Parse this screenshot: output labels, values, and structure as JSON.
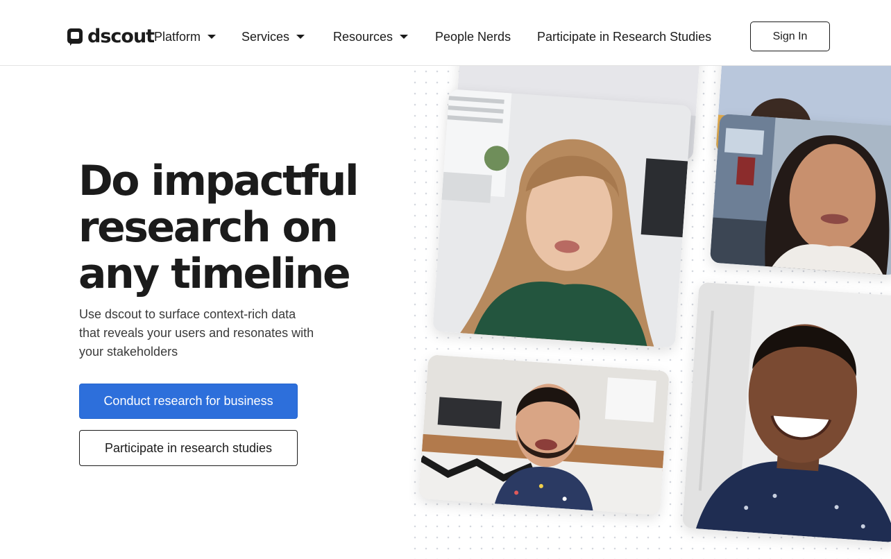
{
  "header": {
    "logo_text": "dscout",
    "nav": [
      {
        "label": "Platform",
        "has_dropdown": true
      },
      {
        "label": "Services",
        "has_dropdown": true
      },
      {
        "label": "Resources",
        "has_dropdown": true
      },
      {
        "label": "People Nerds",
        "has_dropdown": false
      },
      {
        "label": "Participate in Research Studies",
        "has_dropdown": false
      }
    ],
    "sign_in_label": "Sign In"
  },
  "hero": {
    "title_lines": [
      "Do impactful",
      "research on",
      "any timeline"
    ],
    "subtitle": "Use dscout to surface context-rich data that reveals your users and resonates with your stakeholders",
    "primary_cta": "Conduct research for business",
    "secondary_cta": "Participate in research studies"
  },
  "colors": {
    "primary_blue": "#2d6fdb",
    "text_dark": "#1b1b1b",
    "border_light": "#e3e3e3"
  },
  "icons": [
    "dscout-logo-icon",
    "chevron-down-icon"
  ]
}
